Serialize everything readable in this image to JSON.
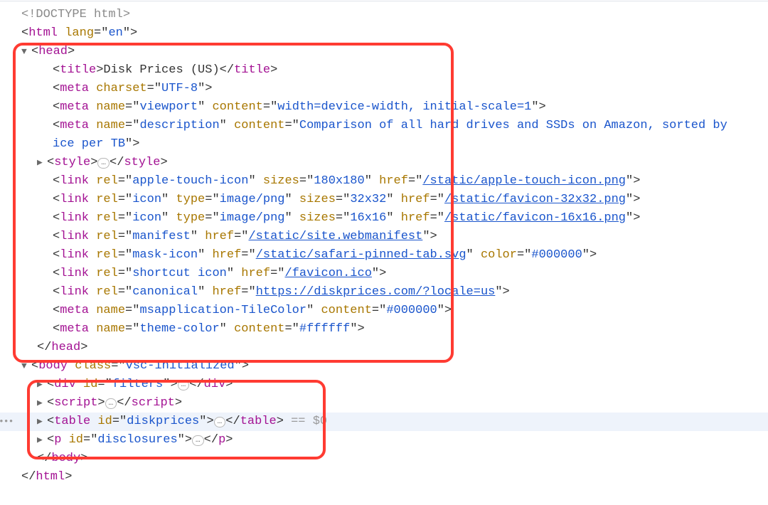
{
  "doctype": "<!DOCTYPE html>",
  "html_open": {
    "tag": "html",
    "attr": "lang",
    "val": "en"
  },
  "head": {
    "open": "head",
    "title": {
      "open": "title",
      "text": "Disk Prices (US)",
      "close": "title"
    },
    "meta_charset": {
      "tag": "meta",
      "attr": "charset",
      "val": "UTF-8"
    },
    "meta_viewport": {
      "tag": "meta",
      "a1": "name",
      "v1": "viewport",
      "a2": "content",
      "v2": "width=device-width, initial-scale=1"
    },
    "meta_desc": {
      "tag": "meta",
      "a1": "name",
      "v1": "description",
      "a2": "content",
      "v2_a": "Comparison of all hard drives and SSDs on Amazon, sorted by",
      "v2_b": "ice per TB"
    },
    "style": {
      "open": "style",
      "close": "style",
      "ell": "…"
    },
    "link_ati": {
      "tag": "link",
      "a1": "rel",
      "v1": "apple-touch-icon",
      "a2": "sizes",
      "v2": "180x180",
      "a3": "href",
      "v3": "/static/apple-touch-icon.png"
    },
    "link_fav32": {
      "tag": "link",
      "a1": "rel",
      "v1": "icon",
      "a2": "type",
      "v2": "image/png",
      "a3": "sizes",
      "v3": "32x32",
      "a4": "href",
      "v4": "/static/favicon-32x32.png"
    },
    "link_fav16": {
      "tag": "link",
      "a1": "rel",
      "v1": "icon",
      "a2": "type",
      "v2": "image/png",
      "a3": "sizes",
      "v3": "16x16",
      "a4": "href",
      "v4": "/static/favicon-16x16.png"
    },
    "link_manifest": {
      "tag": "link",
      "a1": "rel",
      "v1": "manifest",
      "a2": "href",
      "v2": "/static/site.webmanifest"
    },
    "link_mask": {
      "tag": "link",
      "a1": "rel",
      "v1": "mask-icon",
      "a2": "href",
      "v2": "/static/safari-pinned-tab.svg",
      "a3": "color",
      "v3": "#000000"
    },
    "link_shortcut": {
      "tag": "link",
      "a1": "rel",
      "v1": "shortcut icon",
      "a2": "href",
      "v2": "/favicon.ico"
    },
    "link_canonical": {
      "tag": "link",
      "a1": "rel",
      "v1": "canonical",
      "a2": "href",
      "v2": "https://diskprices.com/?locale=us"
    },
    "meta_tile": {
      "tag": "meta",
      "a1": "name",
      "v1": "msapplication-TileColor",
      "a2": "content",
      "v2": "#000000"
    },
    "meta_theme": {
      "tag": "meta",
      "a1": "name",
      "v1": "theme-color",
      "a2": "content",
      "v2": "#ffffff"
    },
    "close": "head"
  },
  "body": {
    "open": "body",
    "attr": "class",
    "val": "vsc-initialized",
    "div_filters": {
      "tag": "div",
      "a": "id",
      "v": "filters",
      "ell": "…"
    },
    "script": {
      "open": "script",
      "close": "script",
      "ell": "…"
    },
    "table": {
      "tag": "table",
      "a": "id",
      "v": "diskprices",
      "ell": "…",
      "sel": " == $0"
    },
    "p_disc": {
      "tag": "p",
      "a": "id",
      "v": "disclosures",
      "ell": "…"
    },
    "close": "body"
  },
  "html_close": "html"
}
